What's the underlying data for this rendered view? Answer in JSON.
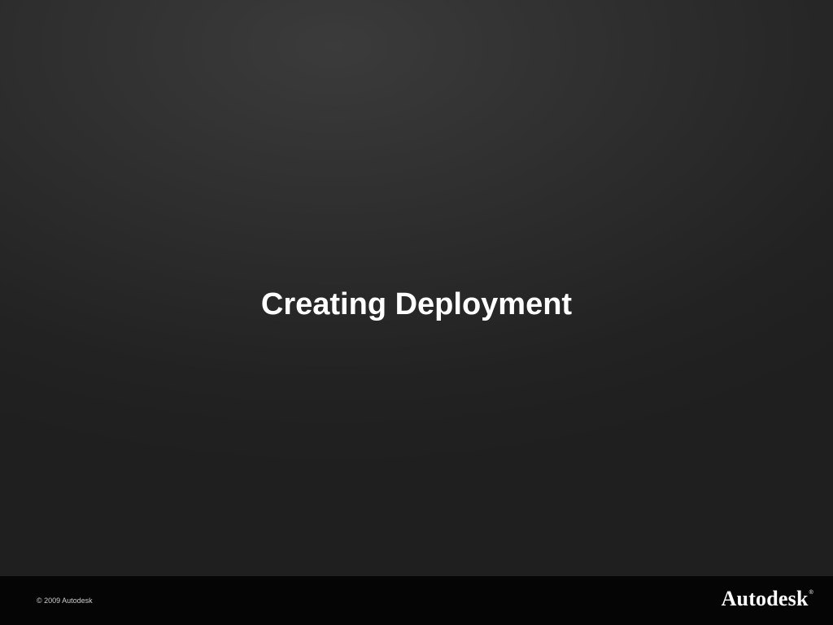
{
  "slide": {
    "title": "Creating Deployment"
  },
  "footer": {
    "copyright": "© 2009 Autodesk",
    "logo_text": "Autodesk",
    "logo_mark": "®"
  },
  "colors": {
    "background_top": "#3b3b3b",
    "background_bottom": "#1f1f1f",
    "footer_bar": "#050505",
    "title_text": "#ffffff"
  }
}
